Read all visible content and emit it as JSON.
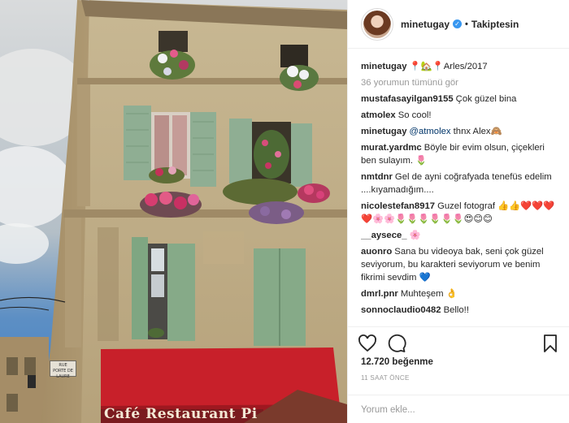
{
  "post": {
    "photo": {
      "restaurant_sign": "Café Restaurant Pi",
      "street_sign": "RUE\nPORTE DE\nLAURE"
    },
    "header": {
      "username": "minetugay",
      "verified_icon": "verified-badge-icon",
      "separator": "•",
      "follow_status": "Takiptesin"
    },
    "caption": {
      "username": "minetugay",
      "text": "📍🏡📍Arles/2017"
    },
    "view_all_comments": "36 yorumun tümünü gör",
    "comments": [
      {
        "user": "mustafasayilgan9155",
        "text": "Çok güzel bina"
      },
      {
        "user": "atmolex",
        "text": "So cool!"
      },
      {
        "user": "minetugay",
        "mention": "@atmolex",
        "text": "thnx Alex🙈"
      },
      {
        "user": "murat.yardmc",
        "text": "Böyle bir evim olsun, çiçekleri ben sulayım. 🌷"
      },
      {
        "user": "nmtdnr",
        "text": "Gel de ayni coğrafyada tenefüs edelim ....kıyamadığım...."
      },
      {
        "user": "nicolestefan8917",
        "text": "Guzel fotograf 👍👍❤️❤️❤️❤️🌸🌸🌷🌷🌷🌷🌷🌷😍😊😊"
      },
      {
        "user": "__aysece_",
        "text": "🌸"
      },
      {
        "user": "auonro",
        "text": "Sana bu videoya bak, seni çok güzel seviyorum, bu karakteri seviyorum ve benim fikrimi sevdim 💙"
      },
      {
        "user": "dmrl.pnr",
        "text": "Muhteşem 👌"
      },
      {
        "user": "sonnoclaudio0482",
        "text": "Bello!!"
      }
    ],
    "actions": {
      "like_icon": "heart-icon",
      "comment_icon": "comment-bubble-icon",
      "save_icon": "bookmark-icon"
    },
    "likes": "12.720 beğenme",
    "timestamp": "11 SAAT ÖNCE",
    "add_comment_placeholder": "Yorum ekle..."
  },
  "colors": {
    "accent": "#3897f0",
    "text": "#262626",
    "muted": "#999999",
    "border": "#efefef",
    "mention": "#003569",
    "awning": "#c8202a"
  }
}
